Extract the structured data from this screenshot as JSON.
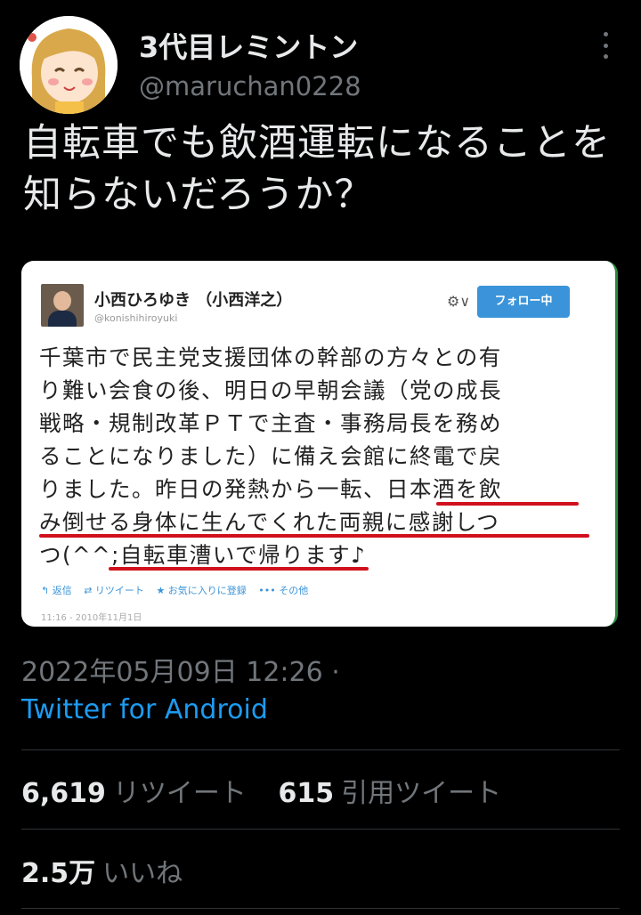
{
  "author": {
    "display_name": "3代目レミントン",
    "handle": "@maruchan0228"
  },
  "tweet": {
    "text": "自転車でも飲酒運転になることを知らないだろうか？"
  },
  "embedded_screenshot": {
    "author_name": "小西ひろゆき （小西洋之）",
    "author_handle": "@konishihiroyuki",
    "settings_label": "⚙∨",
    "follow_label": "フォロー中",
    "body_lines": [
      "千葉市で民主党支援団体の幹部の方々との有",
      "り難い会食の後、明日の早朝会議（党の成長",
      "戦略・規制改革ＰＴで主査・事務局長を務め",
      "ることになりました）に備え会館に終電で戻",
      "りました。昨日の発熱から一転、日本酒を飲",
      "み倒せる身体に生んでくれた両親に感謝しつ",
      "つ(^^;自転車漕いで帰ります♪"
    ],
    "actions": [
      "↰ 返信",
      "⇄ リツイート",
      "★ お気に入りに登録",
      "••• その他"
    ],
    "date": "11:16 - 2010年11月1日"
  },
  "meta": {
    "timestamp": "2022年05月09日 12:26 ·",
    "source": "Twitter for Android"
  },
  "stats": {
    "retweets_count": "6,619",
    "retweets_label": "リツイート",
    "quotes_count": "615",
    "quotes_label": "引用ツイート",
    "likes_count": "2.5万",
    "likes_label": "いいね"
  },
  "colors": {
    "background": "#000000",
    "link": "#1d9bf0",
    "underline": "#d0101c"
  }
}
